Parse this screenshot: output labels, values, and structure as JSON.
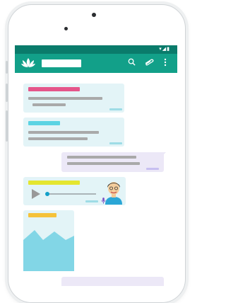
{
  "app": {
    "title": "",
    "status_icons": "▾◢▮"
  },
  "colors": {
    "statusbar": "#0a7b6b",
    "appbar": "#12a089",
    "incoming_bubble": "#e3f4f7",
    "outgoing_bubble": "#ece8f7",
    "tag_pink": "#e5558a",
    "tag_cyan": "#5bd3e3",
    "tag_yellow": "#e4e630",
    "tag_orange": "#f5c23a"
  },
  "icons": {
    "logo": "lotus-logo-icon",
    "search": "search-icon",
    "attach": "paperclip-icon",
    "menu": "more-vert-icon",
    "play": "play-icon",
    "mic": "microphone-icon",
    "image": "image-placeholder-icon"
  },
  "messages": [
    {
      "type": "text",
      "direction": "in",
      "tag_color": "pink"
    },
    {
      "type": "text",
      "direction": "in",
      "tag_color": "cyan"
    },
    {
      "type": "text",
      "direction": "out"
    },
    {
      "type": "audio",
      "direction": "in",
      "tag_color": "yellow",
      "progress": 0.1
    },
    {
      "type": "image",
      "direction": "in",
      "tag_color": "orange"
    }
  ]
}
